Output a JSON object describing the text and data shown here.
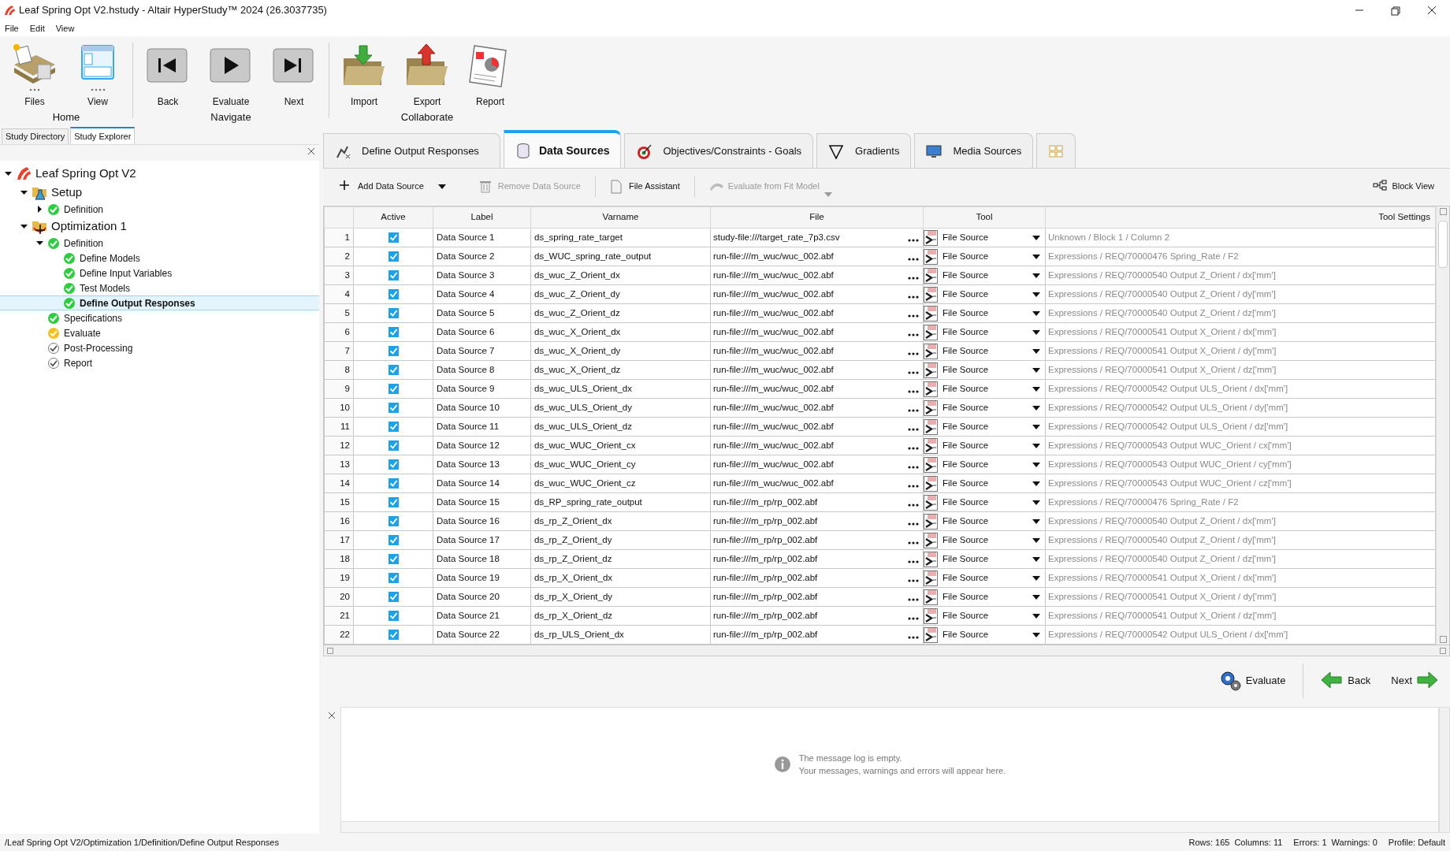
{
  "window": {
    "title": "Leaf Spring Opt V2.hstudy - Altair HyperStudy™ 2024 (26.3037735)"
  },
  "menu": [
    "File",
    "Edit",
    "View"
  ],
  "ribbon": [
    {
      "label": "Home",
      "buttons": [
        {
          "label": "Files",
          "kind": "files"
        },
        {
          "label": "View",
          "kind": "view"
        }
      ]
    },
    {
      "label": "Navigate",
      "buttons": [
        {
          "label": "Back",
          "kind": "back"
        },
        {
          "label": "Evaluate",
          "kind": "play"
        },
        {
          "label": "Next",
          "kind": "next"
        }
      ]
    },
    {
      "label": "Collaborate",
      "buttons": [
        {
          "label": "Import",
          "kind": "import"
        },
        {
          "label": "Export",
          "kind": "export"
        },
        {
          "label": "Report",
          "kind": "report"
        }
      ]
    }
  ],
  "sidebar": {
    "tabs": [
      {
        "label": "Study Directory",
        "selected": false
      },
      {
        "label": "Study Explorer",
        "selected": true
      }
    ],
    "tree": [
      {
        "label": "Leaf Spring Opt V2",
        "kind": "study",
        "expanded": true,
        "selected": false,
        "children": [
          {
            "label": "Setup",
            "kind": "setup",
            "expanded": true,
            "selected": false,
            "children": [
              {
                "label": "Definition",
                "kind": "step",
                "complete": true,
                "warning": false,
                "expanded": false,
                "selected": false
              }
            ]
          },
          {
            "label": "Optimization 1",
            "kind": "optimization",
            "expanded": true,
            "selected": false,
            "children": [
              {
                "label": "Definition",
                "kind": "step",
                "complete": true,
                "warning": false,
                "expanded": true,
                "selected": false,
                "children": [
                  {
                    "label": "Define Models",
                    "kind": "step",
                    "complete": true,
                    "warning": false,
                    "selected": false
                  },
                  {
                    "label": "Define Input Variables",
                    "kind": "step",
                    "complete": true,
                    "warning": false,
                    "selected": false
                  },
                  {
                    "label": "Test Models",
                    "kind": "step",
                    "complete": true,
                    "warning": false,
                    "selected": false
                  },
                  {
                    "label": "Define Output Responses",
                    "kind": "step",
                    "complete": true,
                    "warning": false,
                    "selected": true
                  }
                ]
              },
              {
                "label": "Specifications",
                "kind": "step",
                "complete": true,
                "warning": false,
                "selected": false
              },
              {
                "label": "Evaluate",
                "kind": "step",
                "complete": false,
                "warning": true,
                "selected": false
              },
              {
                "label": "Post-Processing",
                "kind": "step",
                "complete": false,
                "warning": false,
                "selected": false
              },
              {
                "label": "Report",
                "kind": "step",
                "complete": false,
                "warning": false,
                "selected": false
              }
            ]
          }
        ]
      }
    ]
  },
  "tabs": [
    {
      "label": "Define Output Responses",
      "kind": "outputs",
      "selected": false
    },
    {
      "label": "Data Sources",
      "kind": "datasources",
      "selected": true
    },
    {
      "label": "Objectives/Constraints - Goals",
      "kind": "objectives",
      "selected": false
    },
    {
      "label": "Gradients",
      "kind": "gradients",
      "selected": false
    },
    {
      "label": "Media Sources",
      "kind": "media",
      "selected": false
    },
    {
      "kind": "grid",
      "selected": false
    }
  ],
  "toolbar": [
    {
      "label": "Add Data Source",
      "kind": "add",
      "disabled": false
    },
    {
      "label": "Remove Data Source",
      "kind": "remove",
      "disabled": true
    },
    {
      "label": "File Assistant",
      "kind": "file",
      "disabled": false
    },
    {
      "label": "Evaluate from Fit Model",
      "kind": "fit",
      "disabled": true
    },
    {
      "label": "Block View",
      "kind": "block",
      "disabled": false
    }
  ],
  "table": {
    "columns": [
      "Active",
      "Label",
      "Varname",
      "File",
      "Tool",
      "Tool Settings"
    ],
    "rows": [
      {
        "num": "1",
        "active": true,
        "label": "Data Source 1",
        "varname": "ds_spring_rate_target",
        "file": "study-file:///target_rate_7p3.csv",
        "tool": "File Source",
        "settings": "Unknown / Block 1 / Column 2"
      },
      {
        "num": "2",
        "active": true,
        "label": "Data Source 2",
        "varname": "ds_WUC_spring_rate_output",
        "file": "run-file:///m_wuc/wuc_002.abf",
        "tool": "File Source",
        "settings": "Expressions / REQ/70000476 Spring_Rate / F2"
      },
      {
        "num": "3",
        "active": true,
        "label": "Data Source 3",
        "varname": "ds_wuc_Z_Orient_dx",
        "file": "run-file:///m_wuc/wuc_002.abf",
        "tool": "File Source",
        "settings": "Expressions / REQ/70000540 Output Z_Orient / dx['mm']"
      },
      {
        "num": "4",
        "active": true,
        "label": "Data Source 4",
        "varname": "ds_wuc_Z_Orient_dy",
        "file": "run-file:///m_wuc/wuc_002.abf",
        "tool": "File Source",
        "settings": "Expressions / REQ/70000540 Output Z_Orient / dy['mm']"
      },
      {
        "num": "5",
        "active": true,
        "label": "Data Source 5",
        "varname": "ds_wuc_Z_Orient_dz",
        "file": "run-file:///m_wuc/wuc_002.abf",
        "tool": "File Source",
        "settings": "Expressions / REQ/70000540 Output Z_Orient / dz['mm']"
      },
      {
        "num": "6",
        "active": true,
        "label": "Data Source 6",
        "varname": "ds_wuc_X_Orient_dx",
        "file": "run-file:///m_wuc/wuc_002.abf",
        "tool": "File Source",
        "settings": "Expressions / REQ/70000541 Output X_Orient / dx['mm']"
      },
      {
        "num": "7",
        "active": true,
        "label": "Data Source 7",
        "varname": "ds_wuc_X_Orient_dy",
        "file": "run-file:///m_wuc/wuc_002.abf",
        "tool": "File Source",
        "settings": "Expressions / REQ/70000541 Output X_Orient / dy['mm']"
      },
      {
        "num": "8",
        "active": true,
        "label": "Data Source 8",
        "varname": "ds_wuc_X_Orient_dz",
        "file": "run-file:///m_wuc/wuc_002.abf",
        "tool": "File Source",
        "settings": "Expressions / REQ/70000541 Output X_Orient / dz['mm']"
      },
      {
        "num": "9",
        "active": true,
        "label": "Data Source 9",
        "varname": "ds_wuc_ULS_Orient_dx",
        "file": "run-file:///m_wuc/wuc_002.abf",
        "tool": "File Source",
        "settings": "Expressions / REQ/70000542 Output ULS_Orient / dx['mm']"
      },
      {
        "num": "10",
        "active": true,
        "label": "Data Source 10",
        "varname": "ds_wuc_ULS_Orient_dy",
        "file": "run-file:///m_wuc/wuc_002.abf",
        "tool": "File Source",
        "settings": "Expressions / REQ/70000542 Output ULS_Orient / dy['mm']"
      },
      {
        "num": "11",
        "active": true,
        "label": "Data Source 11",
        "varname": "ds_wuc_ULS_Orient_dz",
        "file": "run-file:///m_wuc/wuc_002.abf",
        "tool": "File Source",
        "settings": "Expressions / REQ/70000542 Output ULS_Orient / dz['mm']"
      },
      {
        "num": "12",
        "active": true,
        "label": "Data Source 12",
        "varname": "ds_wuc_WUC_Orient_cx",
        "file": "run-file:///m_wuc/wuc_002.abf",
        "tool": "File Source",
        "settings": "Expressions / REQ/70000543 Output WUC_Orient / cx['mm']"
      },
      {
        "num": "13",
        "active": true,
        "label": "Data Source 13",
        "varname": "ds_wuc_WUC_Orient_cy",
        "file": "run-file:///m_wuc/wuc_002.abf",
        "tool": "File Source",
        "settings": "Expressions / REQ/70000543 Output WUC_Orient / cy['mm']"
      },
      {
        "num": "14",
        "active": true,
        "label": "Data Source 14",
        "varname": "ds_wuc_WUC_Orient_cz",
        "file": "run-file:///m_wuc/wuc_002.abf",
        "tool": "File Source",
        "settings": "Expressions / REQ/70000543 Output WUC_Orient / cz['mm']"
      },
      {
        "num": "15",
        "active": true,
        "label": "Data Source 15",
        "varname": "ds_RP_spring_rate_output",
        "file": "run-file:///m_rp/rp_002.abf",
        "tool": "File Source",
        "settings": "Expressions / REQ/70000476 Spring_Rate / F2"
      },
      {
        "num": "16",
        "active": true,
        "label": "Data Source 16",
        "varname": "ds_rp_Z_Orient_dx",
        "file": "run-file:///m_rp/rp_002.abf",
        "tool": "File Source",
        "settings": "Expressions / REQ/70000540 Output Z_Orient / dx['mm']"
      },
      {
        "num": "17",
        "active": true,
        "label": "Data Source 17",
        "varname": "ds_rp_Z_Orient_dy",
        "file": "run-file:///m_rp/rp_002.abf",
        "tool": "File Source",
        "settings": "Expressions / REQ/70000540 Output Z_Orient / dy['mm']"
      },
      {
        "num": "18",
        "active": true,
        "label": "Data Source 18",
        "varname": "ds_rp_Z_Orient_dz",
        "file": "run-file:///m_rp/rp_002.abf",
        "tool": "File Source",
        "settings": "Expressions / REQ/70000540 Output Z_Orient / dz['mm']"
      },
      {
        "num": "19",
        "active": true,
        "label": "Data Source 19",
        "varname": "ds_rp_X_Orient_dx",
        "file": "run-file:///m_rp/rp_002.abf",
        "tool": "File Source",
        "settings": "Expressions / REQ/70000541 Output X_Orient / dx['mm']"
      },
      {
        "num": "20",
        "active": true,
        "label": "Data Source 20",
        "varname": "ds_rp_X_Orient_dy",
        "file": "run-file:///m_rp/rp_002.abf",
        "tool": "File Source",
        "settings": "Expressions / REQ/70000541 Output X_Orient / dy['mm']"
      },
      {
        "num": "21",
        "active": true,
        "label": "Data Source 21",
        "varname": "ds_rp_X_Orient_dz",
        "file": "run-file:///m_rp/rp_002.abf",
        "tool": "File Source",
        "settings": "Expressions / REQ/70000541 Output X_Orient / dz['mm']"
      },
      {
        "num": "22",
        "active": true,
        "label": "Data Source 22",
        "varname": "ds_rp_ULS_Orient_dx",
        "file": "run-file:///m_rp/rp_002.abf",
        "tool": "File Source",
        "settings": "Expressions / REQ/70000542 Output ULS_Orient / dx['mm']"
      }
    ]
  },
  "actions": [
    {
      "label": "Evaluate",
      "kind": "evaluate"
    },
    {
      "label": "Back",
      "kind": "back"
    },
    {
      "label": "Next",
      "kind": "next"
    }
  ],
  "message_log": {
    "lines": [
      "The message log is empty.",
      "Your messages, warnings and errors will appear here."
    ]
  },
  "status_bar": {
    "path": "/Leaf Spring Opt V2/Optimization 1/Definition/Define Output Responses",
    "items": [
      "Rows: 165",
      "Columns: 11",
      "Errors: 1",
      "Warnings: 0",
      "Profile: Default"
    ]
  }
}
